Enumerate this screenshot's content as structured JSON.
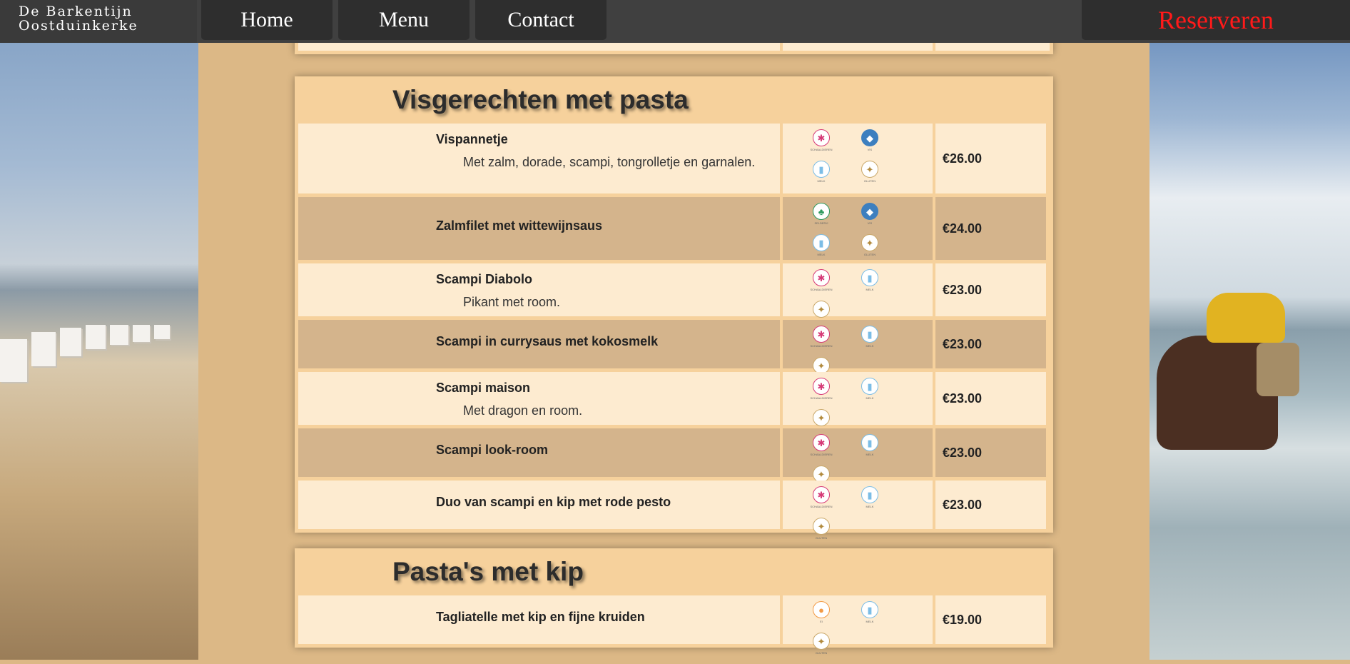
{
  "nav": {
    "brand_line1": "De Barkentijn",
    "brand_line2": "Oostduinkerke",
    "home": "Home",
    "menu": "Menu",
    "contact": "Contact",
    "reserve": "Reserveren"
  },
  "colors": {
    "nav_bg": "#404040",
    "reserve_text": "#ff1a1a",
    "section_bg": "#f6d19c",
    "row_light": "#fdebd0",
    "row_dark": "#d4b48c",
    "page_bg": "#dcb886"
  },
  "sections": [
    {
      "title": "Visgerechten met pasta",
      "items": [
        {
          "name": "Vispannetje",
          "desc": "Met zalm, dorade, scampi, tongrolletje en garnalen.",
          "price": "€26.00",
          "allergens": [
            "schaaldieren",
            "vis",
            "melk",
            "gluten"
          ]
        },
        {
          "name": "Zalmfilet met wittewijnsaus",
          "desc": "",
          "price": "€24.00",
          "allergens": [
            "selderij",
            "vis",
            "melk",
            "gluten"
          ]
        },
        {
          "name": "Scampi Diabolo",
          "desc": "Pikant met room.",
          "price": "€23.00",
          "allergens": [
            "schaaldieren",
            "melk",
            "gluten"
          ]
        },
        {
          "name": "Scampi in currysaus met kokosmelk",
          "desc": "",
          "price": "€23.00",
          "allergens": [
            "schaaldieren",
            "melk",
            "gluten"
          ]
        },
        {
          "name": "Scampi maison",
          "desc": "Met dragon en room.",
          "price": "€23.00",
          "allergens": [
            "schaaldieren",
            "melk",
            "gluten"
          ]
        },
        {
          "name": "Scampi look-room",
          "desc": "",
          "price": "€23.00",
          "allergens": [
            "schaaldieren",
            "melk",
            "gluten"
          ]
        },
        {
          "name": "Duo van scampi en kip met rode pesto",
          "desc": "",
          "price": "€23.00",
          "allergens": [
            "schaaldieren",
            "melk",
            "gluten"
          ]
        }
      ]
    },
    {
      "title": "Pasta's met kip",
      "items": [
        {
          "name": "Tagliatelle met kip en fijne kruiden",
          "desc": "",
          "price": "€19.00",
          "allergens": [
            "ei",
            "melk",
            "gluten"
          ]
        }
      ]
    }
  ],
  "allergen_icons": {
    "schaaldieren": {
      "icon": "lobster-icon",
      "glyph": "✱",
      "label": "SCHAALDIEREN"
    },
    "vis": {
      "icon": "fish-icon",
      "glyph": "◆",
      "label": "VIS"
    },
    "melk": {
      "icon": "milk-bottle-icon",
      "glyph": "▮",
      "label": "MELK"
    },
    "gluten": {
      "icon": "wheat-icon",
      "glyph": "✦",
      "label": "GLUTEN"
    },
    "selderij": {
      "icon": "celery-icon",
      "glyph": "♣",
      "label": "SELDERIJ"
    },
    "ei": {
      "icon": "egg-icon",
      "glyph": "●",
      "label": "EI"
    }
  }
}
